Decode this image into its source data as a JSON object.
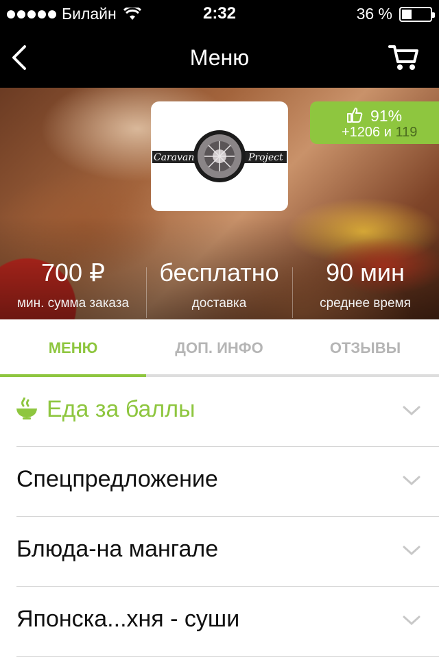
{
  "status_bar": {
    "carrier": "Билайн",
    "time": "2:32",
    "battery_text": "36 %",
    "battery_level": 0.36
  },
  "nav": {
    "title": "Меню",
    "back_icon": "chevron-left-icon",
    "cart_icon": "cart-icon"
  },
  "restaurant": {
    "logo_text_left": "Caravan",
    "logo_text_right": "Project",
    "rating": {
      "percent": "91%",
      "positive": "+1206",
      "connector": "и",
      "negative": "119",
      "icon": "thumbs-up-icon"
    },
    "stats": [
      {
        "value": "700 ₽",
        "label": "мин. сумма заказа"
      },
      {
        "value": "бесплатно",
        "label": "доставка"
      },
      {
        "value": "90 мин",
        "label": "среднее время"
      }
    ]
  },
  "tabs": [
    {
      "label": "МЕНЮ",
      "active": true
    },
    {
      "label": "ДОП. ИНФО",
      "active": false
    },
    {
      "label": "ОТЗЫВЫ",
      "active": false
    }
  ],
  "menu": [
    {
      "label": "Еда за баллы",
      "icon": "bowl-icon"
    },
    {
      "label": "Спецпредложение"
    },
    {
      "label": "Блюда-на мангале"
    },
    {
      "label": "Японска...хня - суши"
    }
  ],
  "colors": {
    "accent": "#8ec63f",
    "text": "#111111",
    "inactive_tab": "#b5b5b5"
  }
}
